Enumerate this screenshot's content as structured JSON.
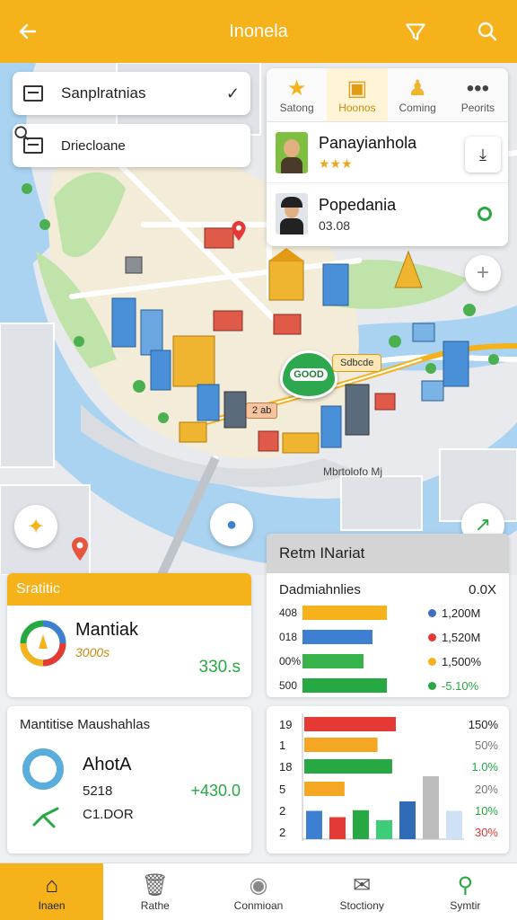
{
  "header": {
    "title": "Inonela",
    "accent": "#f5b21b"
  },
  "search": [
    {
      "text": "Sanplratnias"
    },
    {
      "text": "Driecloane"
    }
  ],
  "poi_tabs": [
    {
      "label": "Satong",
      "icon": "star-icon"
    },
    {
      "label": "Hoonos",
      "icon": "box-icon"
    },
    {
      "label": "Coming",
      "icon": "person-icon"
    },
    {
      "label": "Peorits",
      "icon": "more-icon"
    }
  ],
  "poi_list": [
    {
      "name": "Panayianhola",
      "sub": "★★★"
    },
    {
      "name": "Popedania",
      "sub": "03.08"
    }
  ],
  "map_labels": {
    "badge_green": "GOOD",
    "bubble": "Sdbcde",
    "tag": "2 ab",
    "district": "Mbrtolofo Mj"
  },
  "stats_card": {
    "header": "Sratitic",
    "name": "Mantiak",
    "sub": "3000s",
    "value": "330.s"
  },
  "retm_card": {
    "header": "Retm INariat",
    "title": "Dadmiahnlies",
    "pct": "0.0X",
    "rows": [
      {
        "label": "408",
        "value": "1,200M",
        "pct": 0.72,
        "color": "#f5b21b",
        "dot": "#3d6cc0"
      },
      {
        "label": "018",
        "value": "1,520M",
        "pct": 0.6,
        "color": "#3d7fd0",
        "dot": "#e53935"
      },
      {
        "label": "00%",
        "value": "1,500%",
        "pct": 0.52,
        "color": "#36b34a",
        "dot": "#f5b21b"
      },
      {
        "label": "500",
        "value": "-5.10%",
        "pct": 0.72,
        "color": "#27a843",
        "dot": "#27a843"
      }
    ]
  },
  "donut_card": {
    "title": "Mantitise Maushahlas",
    "name": "AhotA",
    "line1": "5218",
    "line2": "C1.DOR",
    "value": "+430.0"
  },
  "chart_data": {
    "type": "bar",
    "y_labels": [
      "19",
      "1",
      "18",
      "5",
      "2",
      "2"
    ],
    "right_labels": [
      "150%",
      "50%",
      "1.0%",
      "20%",
      "10%",
      "30%"
    ],
    "right_colors": [
      "#222",
      "#777",
      "#27a843",
      "#777",
      "#27a843",
      "#e53935"
    ],
    "h_bars": [
      {
        "value": 0.75,
        "color": "#e53935"
      },
      {
        "value": 0.6,
        "color": "#f5a623"
      },
      {
        "value": 0.72,
        "color": "#27a843"
      },
      {
        "value": 0.33,
        "color": "#f5a623"
      }
    ],
    "v_bars": [
      {
        "value": 0.45,
        "color": "#3d7fd0"
      },
      {
        "value": 0.35,
        "color": "#e53935"
      },
      {
        "value": 0.46,
        "color": "#27a843"
      },
      {
        "value": 0.3,
        "color": "#3ecc78"
      },
      {
        "value": 0.6,
        "color": "#2f6bb7"
      },
      {
        "value": 1.0,
        "color": "#bdbdbd"
      },
      {
        "value": 0.45,
        "color": "#cfe2f5"
      }
    ]
  },
  "bottom_nav": [
    {
      "label": "Inaen",
      "icon": "home-icon",
      "active": true
    },
    {
      "label": "Rathe",
      "icon": "trash-icon",
      "active": false
    },
    {
      "label": "Conmioan",
      "icon": "chat-icon",
      "active": false
    },
    {
      "label": "Stoctiony",
      "icon": "inbox-icon",
      "active": false
    },
    {
      "label": "Symtir",
      "icon": "search-icon",
      "active": false
    }
  ]
}
